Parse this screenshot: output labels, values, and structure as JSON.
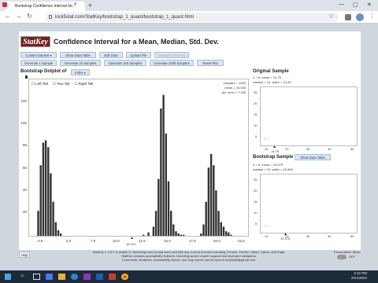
{
  "browser": {
    "tab_title": "Bootstrap Confidence Interval for...",
    "url": "lock5stat.com/StatKey/bootstrap_1_quant/bootstrap_1_quant.html"
  },
  "app": {
    "logo": "StatKey",
    "title": "Confidence Interval for a Mean, Median, Std. Dev.",
    "buttons_row1": [
      "Custom Dataset ▾",
      "Show Data Table",
      "Edit Data",
      "Upload File",
      "Change Column(s)"
    ],
    "buttons_row2": [
      "Generate 1 Sample",
      "Generate 10 Samples",
      "Generate 100 Samples",
      "Generate 1000 Samples",
      "Reset Plot"
    ]
  },
  "dotplot": {
    "label": "Bootstrap Dotplot of",
    "stat_select": "Index ▾",
    "tails": [
      "Left Tail",
      "Two-Tail",
      "Right Tail"
    ],
    "stats": [
      "samples = 1000",
      "mean = 15.045",
      "std. error = 7.338"
    ],
    "y_ticks": [
      "120",
      "100",
      "80",
      "60",
      "40",
      "20"
    ],
    "x_ticks": [
      "2.5",
      "5.0",
      "7.5",
      "10.0",
      "12.5",
      "15.0",
      "17.5",
      "20.0",
      "22.5"
    ],
    "marker_label": "15.101"
  },
  "original": {
    "title": "Original Sample",
    "line1": "n = 8, mean = 14.75",
    "line2": "median = 10, stdev = 14.39",
    "y_ticks": [
      "25",
      "20",
      "15",
      "10",
      "5"
    ],
    "x_ticks": [
      "10",
      "20",
      "30",
      "40",
      "50"
    ],
    "marker_label": "14.75"
  },
  "bootstrap": {
    "title": "Bootstrap Sample",
    "show_btn": "Show Data Table",
    "line1": "n = 8, mean = 19.375",
    "line2": "median = 10, stdev = 18.996",
    "y_ticks": [
      "25",
      "20",
      "15",
      "10",
      "5"
    ],
    "x_ticks": [
      "10",
      "20",
      "30",
      "40",
      "50"
    ],
    "marker_label": "19.375"
  },
  "footer": {
    "help": "Help",
    "line1": "StatKey v. 3.0.2 is written in JavaScript and should work well with any current browser including Chrome, Firefox, Safari, Opera, and Edge.",
    "line2": "StatKey contains accessibility features, including screen reader support and keyboard navigation.",
    "line3": "Comments, feedback, accessibility issues, and bug reports can be sent to lock5stat@gmail.com.",
    "presentation": "Presentation Mode",
    "toggle": "OFF"
  },
  "taskbar": {
    "time": "2:22 PM",
    "date": "2/21/2022"
  },
  "chart_data": {
    "type": "bar",
    "title": "",
    "xlabel": "",
    "ylabel": "",
    "ylim": [
      0,
      130
    ],
    "xlim": [
      1,
      23
    ],
    "x": [
      2.0,
      2.25,
      2.5,
      2.75,
      3.0,
      3.25,
      3.5,
      3.75,
      4.0,
      4.25,
      12.5,
      13.0,
      13.5,
      13.75,
      14.0,
      14.25,
      14.5,
      14.75,
      15.0,
      15.25,
      15.5,
      15.75,
      16.0,
      16.25,
      16.5,
      18.25,
      18.5,
      18.75,
      19.0,
      19.25,
      19.5,
      19.75,
      20.0,
      20.25,
      20.5,
      20.75,
      21.0,
      21.25
    ],
    "values": [
      22,
      62,
      82,
      84,
      78,
      55,
      30,
      12,
      5,
      2,
      1,
      3,
      8,
      22,
      50,
      112,
      124,
      90,
      48,
      22,
      10,
      4,
      2,
      1,
      1,
      2,
      10,
      30,
      60,
      72,
      62,
      40,
      22,
      12,
      8,
      4,
      3,
      1
    ]
  }
}
